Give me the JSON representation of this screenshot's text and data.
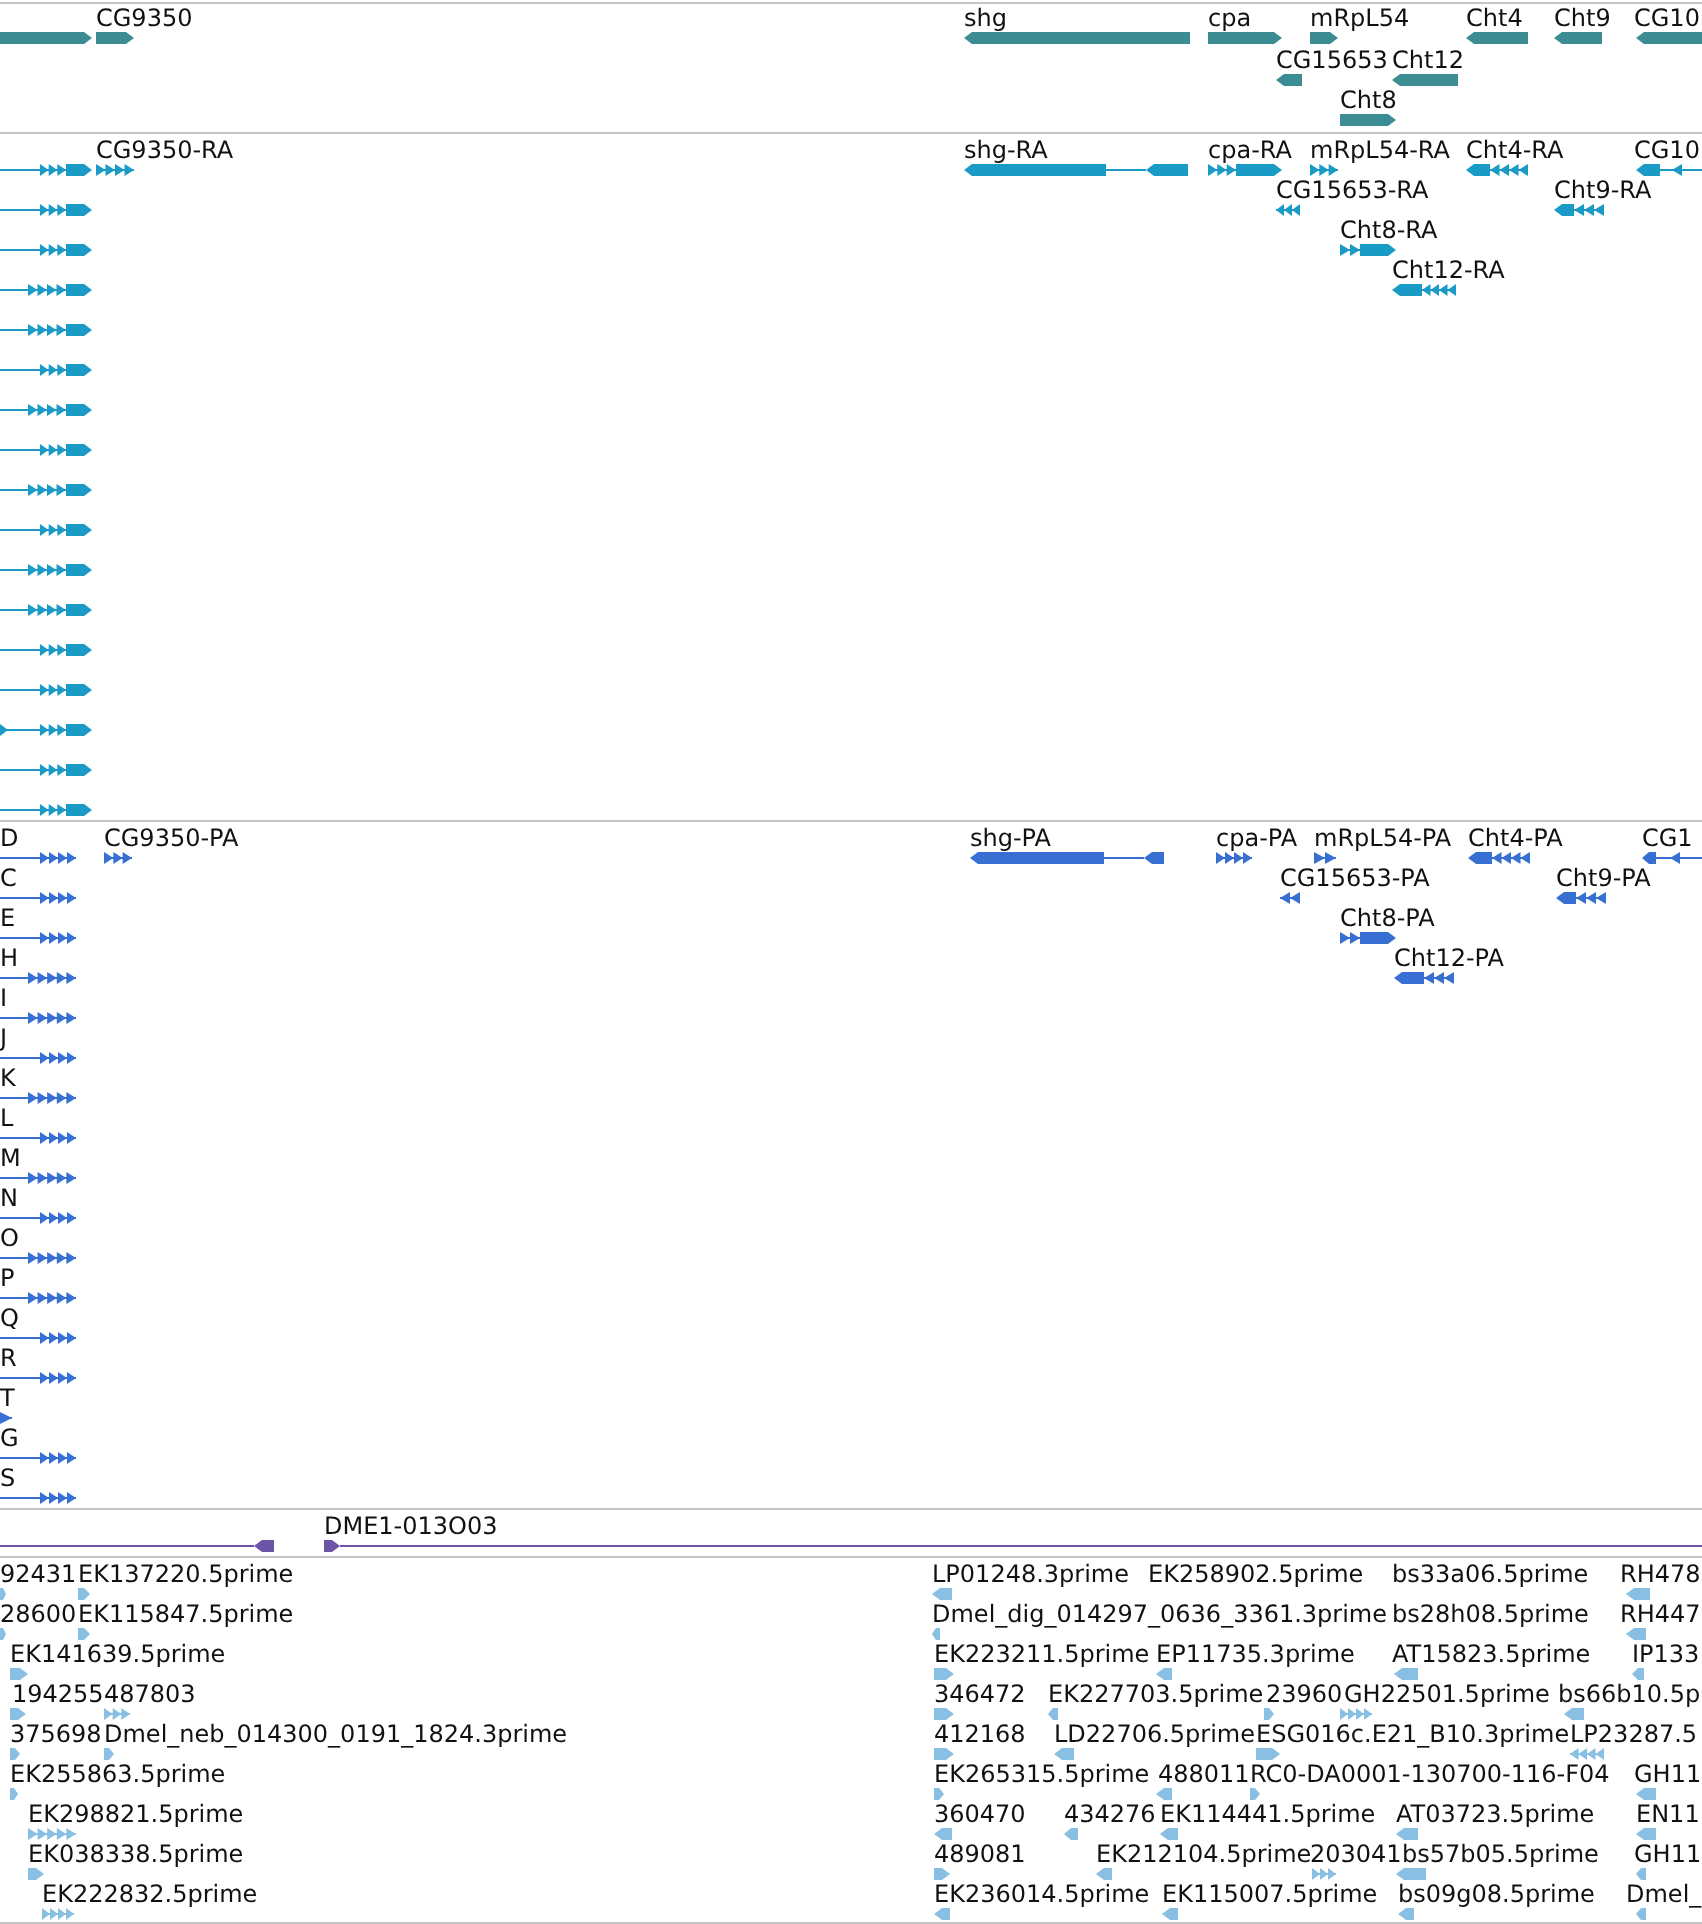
{
  "tracks": [
    {
      "kind": "gene",
      "features": [
        {
          "reverse": false
        },
        {
          "label": "CG9350",
          "reverse": false
        },
        {
          "label": "shg",
          "reverse": true
        },
        {
          "label": "cpa",
          "reverse": false
        },
        {
          "label": "mRpL54",
          "reverse": false
        },
        {
          "label": "Cht4",
          "reverse": true
        },
        {
          "label": "Cht9",
          "reverse": true
        },
        {
          "label": "CG10",
          "reverse": true
        },
        {
          "label": "CG15653",
          "reverse": true
        },
        {
          "label": "Cht12",
          "reverse": true
        },
        {
          "label": "Cht8",
          "reverse": false
        }
      ]
    },
    {
      "kind": "transcript",
      "features": [
        {
          "reverse": false
        },
        {
          "label": "CG9350-RA",
          "reverse": false
        },
        {
          "label": "shg-RA",
          "reverse": true
        },
        {
          "label": "cpa-RA",
          "reverse": false
        },
        {
          "label": "mRpL54-RA",
          "reverse": false
        },
        {
          "label": "Cht4-RA",
          "reverse": true
        },
        {
          "label": "CG10",
          "reverse": true
        },
        {
          "reverse": false
        },
        {
          "label": "CG15653-RA",
          "reverse": true
        },
        {
          "label": "Cht9-RA",
          "reverse": true
        },
        {
          "reverse": false
        },
        {
          "label": "Cht8-RA",
          "reverse": false
        },
        {
          "reverse": false
        },
        {
          "label": "Cht12-RA",
          "reverse": true
        },
        {
          "reverse": false
        },
        {
          "reverse": false
        },
        {
          "reverse": false
        },
        {
          "reverse": false
        },
        {
          "reverse": false
        },
        {
          "reverse": false
        },
        {
          "reverse": false
        },
        {
          "reverse": false
        },
        {
          "reverse": false
        },
        {
          "reverse": false
        },
        {
          "reverse": false
        },
        {
          "reverse": false
        },
        {
          "reverse": false
        }
      ]
    },
    {
      "kind": "protein",
      "features": [
        {
          "label": "D",
          "reverse": false
        },
        {
          "label": "CG9350-PA",
          "reverse": false
        },
        {
          "label": "shg-PA",
          "reverse": true
        },
        {
          "label": "cpa-PA",
          "reverse": false
        },
        {
          "label": "mRpL54-PA",
          "reverse": false
        },
        {
          "label": "Cht4-PA",
          "reverse": true
        },
        {
          "label": "CG1",
          "reverse": true
        },
        {
          "label": "C",
          "reverse": false
        },
        {
          "label": "CG15653-PA",
          "reverse": true
        },
        {
          "label": "Cht9-PA",
          "reverse": true
        },
        {
          "label": "E",
          "reverse": false
        },
        {
          "label": "Cht8-PA",
          "reverse": false
        },
        {
          "label": "H",
          "reverse": false
        },
        {
          "label": "Cht12-PA",
          "reverse": true
        },
        {
          "label": "I",
          "reverse": false
        },
        {
          "label": "J",
          "reverse": false
        },
        {
          "label": "K",
          "reverse": false
        },
        {
          "label": "L",
          "reverse": false
        },
        {
          "label": "M",
          "reverse": false
        },
        {
          "label": "N",
          "reverse": false
        },
        {
          "label": "O",
          "reverse": false
        },
        {
          "label": "P",
          "reverse": false
        },
        {
          "label": "Q",
          "reverse": false
        },
        {
          "label": "R",
          "reverse": false
        },
        {
          "label": "T",
          "reverse": false
        },
        {
          "label": "G",
          "reverse": false
        },
        {
          "label": "S",
          "reverse": false
        }
      ]
    },
    {
      "kind": "clone",
      "features": [
        {
          "reverse": true
        },
        {
          "label": "DME1-013O03",
          "reverse": false
        }
      ]
    },
    {
      "kind": "est",
      "features": [
        {
          "label": "92431",
          "reverse": false
        },
        {
          "label": "EK137220.5prime",
          "reverse": false
        },
        {
          "label": "LP01248.3prime",
          "reverse": true
        },
        {
          "label": "EK258902.5prime"
        },
        {
          "label": "bs33a06.5prime"
        },
        {
          "label": "RH478",
          "reverse": true
        },
        {
          "label": "28600",
          "reverse": false
        },
        {
          "label": "EK115847.5prime",
          "reverse": false
        },
        {
          "label": "Dmel_dig_014297_0636_3361.3prime",
          "reverse": true
        },
        {
          "label": "bs28h08.5prime"
        },
        {
          "label": "RH447",
          "reverse": true
        },
        {
          "label": "EK141639.5prime",
          "reverse": false
        },
        {
          "label": "EK223211.5prime",
          "reverse": false
        },
        {
          "label": "EP11735.3prime",
          "reverse": true
        },
        {
          "label": "AT15823.5prime",
          "reverse": true
        },
        {
          "label": "IP133",
          "reverse": true
        },
        {
          "label": "194255",
          "reverse": false
        },
        {
          "label": "487803",
          "reverse": false
        },
        {
          "label": "346472",
          "reverse": false
        },
        {
          "label": "EK227703.5prime",
          "reverse": true
        },
        {
          "label": "23960",
          "reverse": false
        },
        {
          "label": "GH22501.5prime",
          "reverse": false
        },
        {
          "label": "bs66b10.5p",
          "reverse": true
        },
        {
          "label": "375698",
          "reverse": false
        },
        {
          "label": "Dmel_neb_014300_0191_1824.3prime",
          "reverse": false
        },
        {
          "label": "412168",
          "reverse": false
        },
        {
          "label": "LD22706.5prime",
          "reverse": true
        },
        {
          "label": "ESG016c.E21_B10.3prime",
          "reverse": false
        },
        {
          "label": "LP23287.5",
          "reverse": true
        },
        {
          "label": "EK255863.5prime",
          "reverse": false
        },
        {
          "label": "EK265315.5prime",
          "reverse": false
        },
        {
          "label": "488011",
          "reverse": true
        },
        {
          "label": "RC0-DA0001-130700-116-F04",
          "reverse": false
        },
        {
          "label": "GH11",
          "reverse": true
        },
        {
          "label": "EK298821.5prime",
          "reverse": false
        },
        {
          "label": "360470",
          "reverse": true
        },
        {
          "label": "434276",
          "reverse": true
        },
        {
          "label": "EK114441.5prime",
          "reverse": true
        },
        {
          "label": "AT03723.5prime",
          "reverse": true
        },
        {
          "label": "EN11",
          "reverse": true
        },
        {
          "label": "EK038338.5prime",
          "reverse": false
        },
        {
          "label": "489081",
          "reverse": false
        },
        {
          "label": "EK212104.5prime",
          "reverse": true
        },
        {
          "label": "203041",
          "reverse": false
        },
        {
          "label": "bs57b05.5prime",
          "reverse": true
        },
        {
          "label": "GH11",
          "reverse": true
        },
        {
          "label": "EK222832.5prime",
          "reverse": false
        },
        {
          "label": "EK236014.5prime",
          "reverse": true
        },
        {
          "label": "EK115007.5prime",
          "reverse": true
        },
        {
          "label": "bs09g08.5prime",
          "reverse": true
        },
        {
          "label": "Dmel_",
          "reverse": true
        }
      ]
    }
  ]
}
